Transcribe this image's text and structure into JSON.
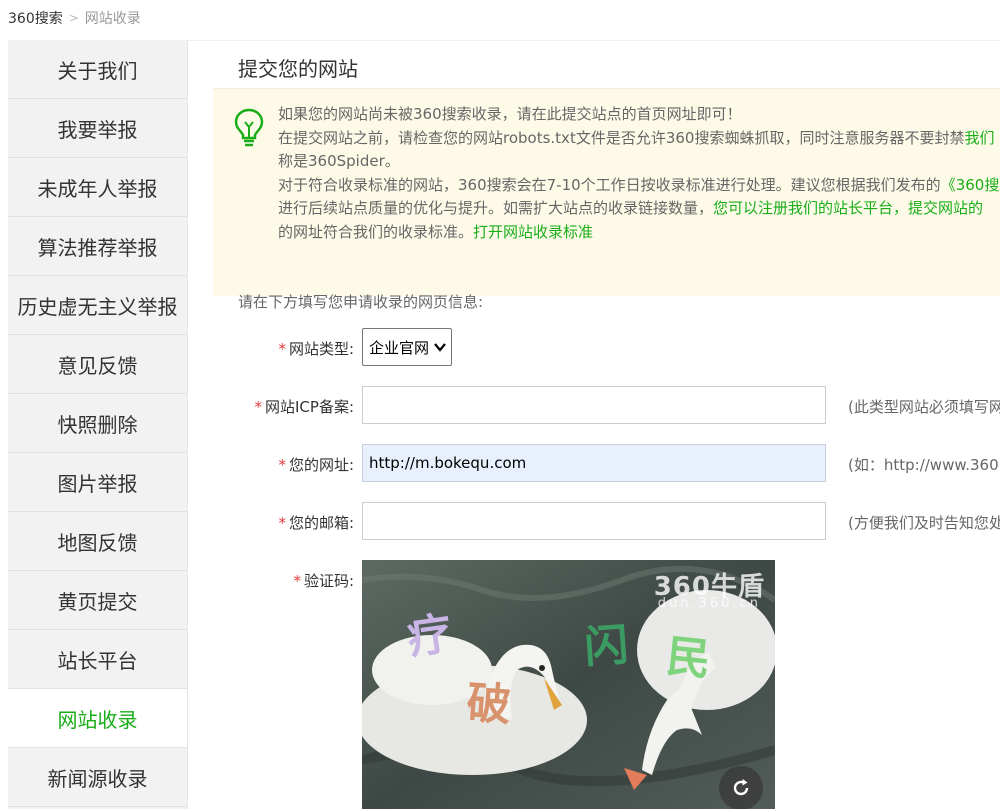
{
  "breadcrumb": {
    "root": "360搜索",
    "current": "网站收录"
  },
  "sidebar": {
    "items": [
      {
        "label": "关于我们"
      },
      {
        "label": "我要举报"
      },
      {
        "label": "未成年人举报"
      },
      {
        "label": "算法推荐举报"
      },
      {
        "label": "历史虚无主义举报"
      },
      {
        "label": "意见反馈"
      },
      {
        "label": "快照删除"
      },
      {
        "label": "图片举报"
      },
      {
        "label": "地图反馈"
      },
      {
        "label": "黄页提交"
      },
      {
        "label": "站长平台"
      },
      {
        "label": "网站收录"
      },
      {
        "label": "新闻源收录"
      }
    ],
    "active_label": "网站收录",
    "active_color": "#1aac19"
  },
  "page_title": "提交您的网站",
  "notice": {
    "line1": "如果您的网站尚未被360搜索收录，请在此提交站点的首页网址即可！",
    "line2_a": "在提交网站之前，请检查您的网站robots.txt文件是否允许360搜索蜘蛛抓取，同时注意服务器不要封禁",
    "line2_b": "我们",
    "line3": "称是360Spider。",
    "line4_a": "对于符合收录标准的网站，360搜索会在7-10个工作日按收录标准进行处理。建议您根据我们发布的",
    "line4_b": "《360搜",
    "line5_a": "进行后续站点质量的优化与提升。如需扩大站点的收录链接数量，",
    "line5_b": "您可以注册我们的站长平台，提交网站的",
    "line6_a": "的网址符合我们的收录标准。",
    "line6_b": "打开网站收录标准"
  },
  "form": {
    "intro": "请在下方填写您申请收录的网页信息:",
    "required_mark": "*",
    "site_type": {
      "label": "网站类型:",
      "value": "企业官网"
    },
    "icp": {
      "label": "网站ICP备案:",
      "value": "",
      "hint": "(此类型网站必须填写网"
    },
    "url": {
      "label": "您的网址:",
      "value": "http://m.bokequ.com",
      "hint": "(如：http://www.360.cn"
    },
    "email": {
      "label": "您的邮箱:",
      "value": "",
      "hint": "(方便我们及时告知您处"
    },
    "captcha": {
      "label": "验证码:",
      "brand": "360牛盾",
      "brand_sub": "dun.360.cn",
      "chars": [
        "疗",
        "破",
        "闪",
        "民"
      ]
    }
  },
  "colors": {
    "green": "#1aac19",
    "notice_bg": "#fdfbe8",
    "required": "#e4393c"
  }
}
